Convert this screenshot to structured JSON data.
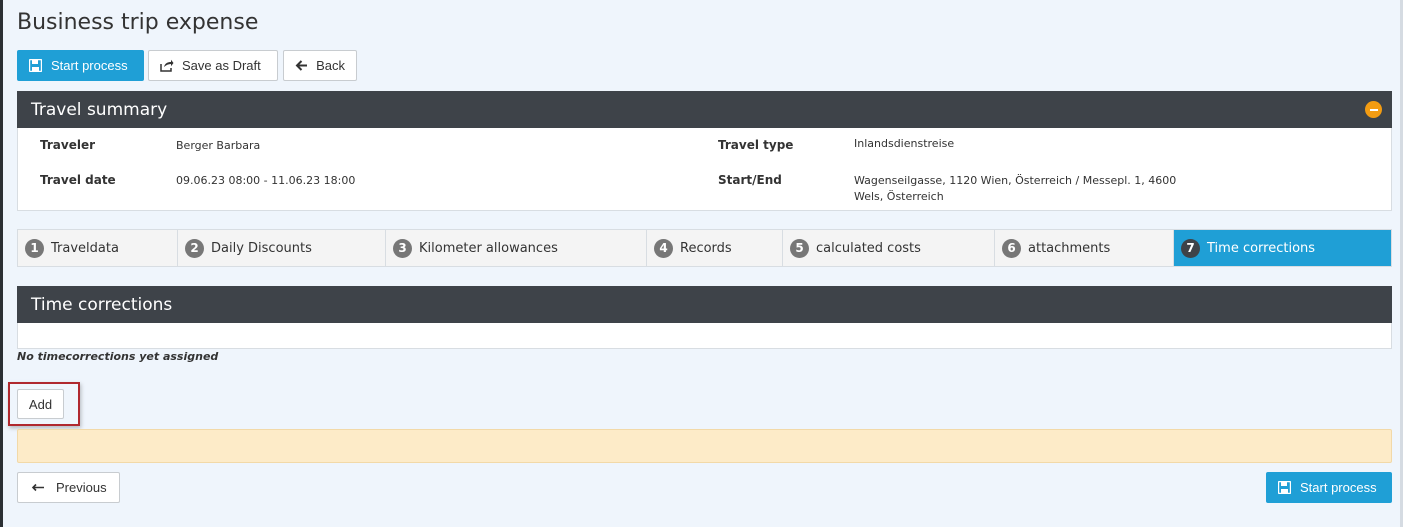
{
  "page": {
    "title": "Business trip expense"
  },
  "toolbar": {
    "start_label": "Start process",
    "draft_label": "Save as Draft",
    "back_label": "Back"
  },
  "summary": {
    "title": "Travel summary",
    "traveler_label": "Traveler",
    "traveler_value": "Berger Barbara",
    "date_label": "Travel date",
    "date_value": "09.06.23 08:00 - 11.06.23 18:00",
    "type_label": "Travel type",
    "type_value": "Inlandsdienstreise",
    "startend_label": "Start/End",
    "startend_line1": "Wagenseilgasse, 1120 Wien, Österreich / Messepl. 1, 4600",
    "startend_line2": "Wels, Österreich"
  },
  "steps": [
    {
      "num": "1",
      "label": "Traveldata"
    },
    {
      "num": "2",
      "label": "Daily Discounts"
    },
    {
      "num": "3",
      "label": "Kilometer allowances"
    },
    {
      "num": "4",
      "label": "Records"
    },
    {
      "num": "5",
      "label": "calculated costs"
    },
    {
      "num": "6",
      "label": "attachments"
    },
    {
      "num": "7",
      "label": "Time corrections"
    }
  ],
  "active_step": 7,
  "corrections": {
    "title": "Time corrections",
    "empty_message": "No timecorrections yet assigned",
    "add_label": "Add"
  },
  "footer": {
    "previous_label": "Previous",
    "start_label": "Start process"
  },
  "colors": {
    "primary": "#1f9fd6",
    "panel_header": "#3e4349",
    "collapse": "#f39c12",
    "alert_bg": "#fdebc8",
    "highlight": "#b0282e"
  }
}
